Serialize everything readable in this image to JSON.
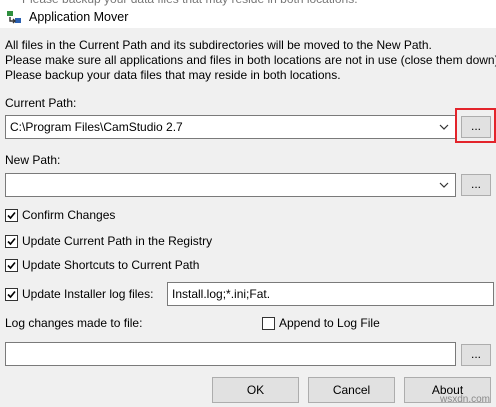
{
  "window": {
    "title": "Application Mover"
  },
  "description": {
    "line1": "All files in the Current Path and its subdirectories will be moved to the New Path.",
    "line2": "Please make sure all applications and files in both locations are not in use (close them down).",
    "line3": "Please backup your data files that may reside in both locations."
  },
  "current_path": {
    "label": "Current Path:",
    "value": "C:\\Program Files\\CamStudio 2.7",
    "browse_label": "..."
  },
  "new_path": {
    "label": "New Path:",
    "value": "",
    "browse_label": "..."
  },
  "options": {
    "confirm_changes": {
      "label": "Confirm Changes",
      "checked": true
    },
    "update_registry": {
      "label": "Update Current Path in the Registry",
      "checked": true
    },
    "update_shortcuts": {
      "label": "Update Shortcuts to Current Path",
      "checked": true
    },
    "update_installer_log": {
      "label": "Update Installer log files:",
      "checked": true,
      "value": "Install.log;*.ini;Fat."
    }
  },
  "log": {
    "label": "Log changes made to file:",
    "append_label": "Append to Log File",
    "append_checked": false,
    "value": "",
    "browse_label": "..."
  },
  "buttons": {
    "ok": "OK",
    "cancel": "Cancel",
    "about": "About"
  },
  "watermark": "wsxdn.com",
  "colors": {
    "highlight": "#e3242b",
    "background": "#f0f0f0",
    "button": "#e1e1e1"
  },
  "icons": {
    "app": "application-mover-icon",
    "check": "check-mark-icon",
    "dropdown": "chevron-down-icon"
  }
}
